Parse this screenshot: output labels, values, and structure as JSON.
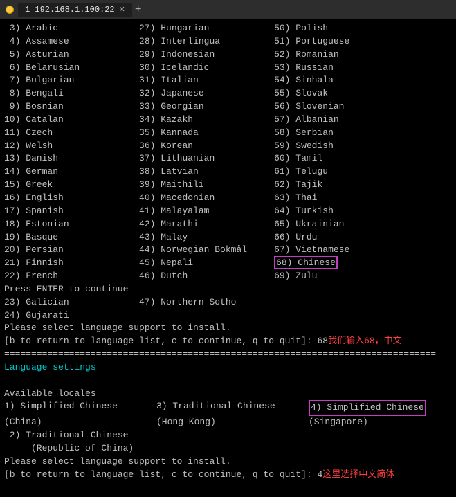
{
  "titlebar": {
    "tab_label": "1 192.168.1.100:22",
    "tab_add": "+"
  },
  "terminal": {
    "lines": [
      {
        "id": "l3",
        "col1": " 3) Arabic               ",
        "col2": "27) Hungarian           ",
        "col3": " 50) Polish"
      },
      {
        "id": "l4",
        "col1": " 4) Assamese              ",
        "col2": "28) Interlingua         ",
        "col3": " 51) Portuguese"
      },
      {
        "id": "l5",
        "col1": " 5) Asturian              ",
        "col2": "29) Indonesian          ",
        "col3": " 52) Romanian"
      },
      {
        "id": "l6",
        "col1": " 6) Belarusian            ",
        "col2": "30) Icelandic           ",
        "col3": " 53) Russian"
      },
      {
        "id": "l7",
        "col1": " 7) Bulgarian             ",
        "col2": "31) Italian             ",
        "col3": " 54) Sinhala"
      },
      {
        "id": "l8",
        "col1": " 8) Bengali               ",
        "col2": "32) Japanese            ",
        "col3": " 55) Slovak"
      },
      {
        "id": "l9",
        "col1": " 9) Bosnian               ",
        "col2": "33) Georgian            ",
        "col3": " 56) Slovenian"
      },
      {
        "id": "l10",
        "col1": "10) Catalan               ",
        "col2": "34) Kazakh              ",
        "col3": " 57) Albanian"
      },
      {
        "id": "l11",
        "col1": "11) Czech                 ",
        "col2": "35) Kannada             ",
        "col3": " 58) Serbian"
      },
      {
        "id": "l12",
        "col1": "12) Welsh                 ",
        "col2": "36) Korean              ",
        "col3": " 59) Swedish"
      },
      {
        "id": "l13",
        "col1": "13) Danish                ",
        "col2": "37) Lithuanian          ",
        "col3": " 60) Tamil"
      },
      {
        "id": "l14",
        "col1": "14) German                ",
        "col2": "38) Latvian             ",
        "col3": " 61) Telugu"
      },
      {
        "id": "l15",
        "col1": "15) Greek                 ",
        "col2": "39) Maithili            ",
        "col3": " 62) Tajik"
      },
      {
        "id": "l16",
        "col1": "16) English               ",
        "col2": "40) Macedonian          ",
        "col3": " 63) Thai"
      },
      {
        "id": "l17",
        "col1": "17) Spanish               ",
        "col2": "41) Malayalam           ",
        "col3": " 64) Turkish"
      },
      {
        "id": "l18",
        "col1": "18) Estonian              ",
        "col2": "42) Marathi             ",
        "col3": " 65) Ukrainian"
      },
      {
        "id": "l19",
        "col1": "19) Basque                ",
        "col2": "43) Malay               ",
        "col3": " 66) Urdu"
      },
      {
        "id": "l20",
        "col1": "20) Persian               ",
        "col2": "44) Norwegian Bokmål    ",
        "col3": " 67) Vietnamese"
      },
      {
        "id": "l21",
        "col1": "21) Finnish               ",
        "col2": "45) Nepali              ",
        "col3": " 68) Chinese ← highlighted"
      },
      {
        "id": "l22",
        "col1": "22) French                ",
        "col2": "46) Dutch               ",
        "col3": " 69) Zulu"
      },
      {
        "id": "press_enter",
        "text": "Press ENTER to continue"
      },
      {
        "id": "l23",
        "col1": "23) Galician              ",
        "col2": "47) Northern Sotho"
      },
      {
        "id": "l24",
        "col1": "24) Gujarati"
      }
    ],
    "prompt1": "[b to return to language list, c to continue, q to quit]: 68",
    "chinese_note": "  我们输入68，中文",
    "divider": "================================================================================",
    "section": "Language settings",
    "blank1": "",
    "avail": "Available locales",
    "locale1_num": " 1) ",
    "locale1_name": "Simplified Chinese",
    "locale1_sub": "     (China)",
    "locale3_num": "3) ",
    "locale3_name": "Traditional Chinese",
    "locale3_sub": "  (Hong Kong)",
    "locale4_num": "4) ",
    "locale4_name": "Simplified Chinese",
    "locale4_sub": "   (Singapore)",
    "locale2_num": " 2) ",
    "locale2_name": "Traditional Chinese",
    "locale2_sub": "     (Republic of China)",
    "prompt2_text": "Please select language support to install.",
    "prompt2_line": "[b to return to language list, c to continue, q to quit]: 4",
    "chinese_note2": "  这里选择中文简体",
    "please1": "Please select language support to install."
  }
}
